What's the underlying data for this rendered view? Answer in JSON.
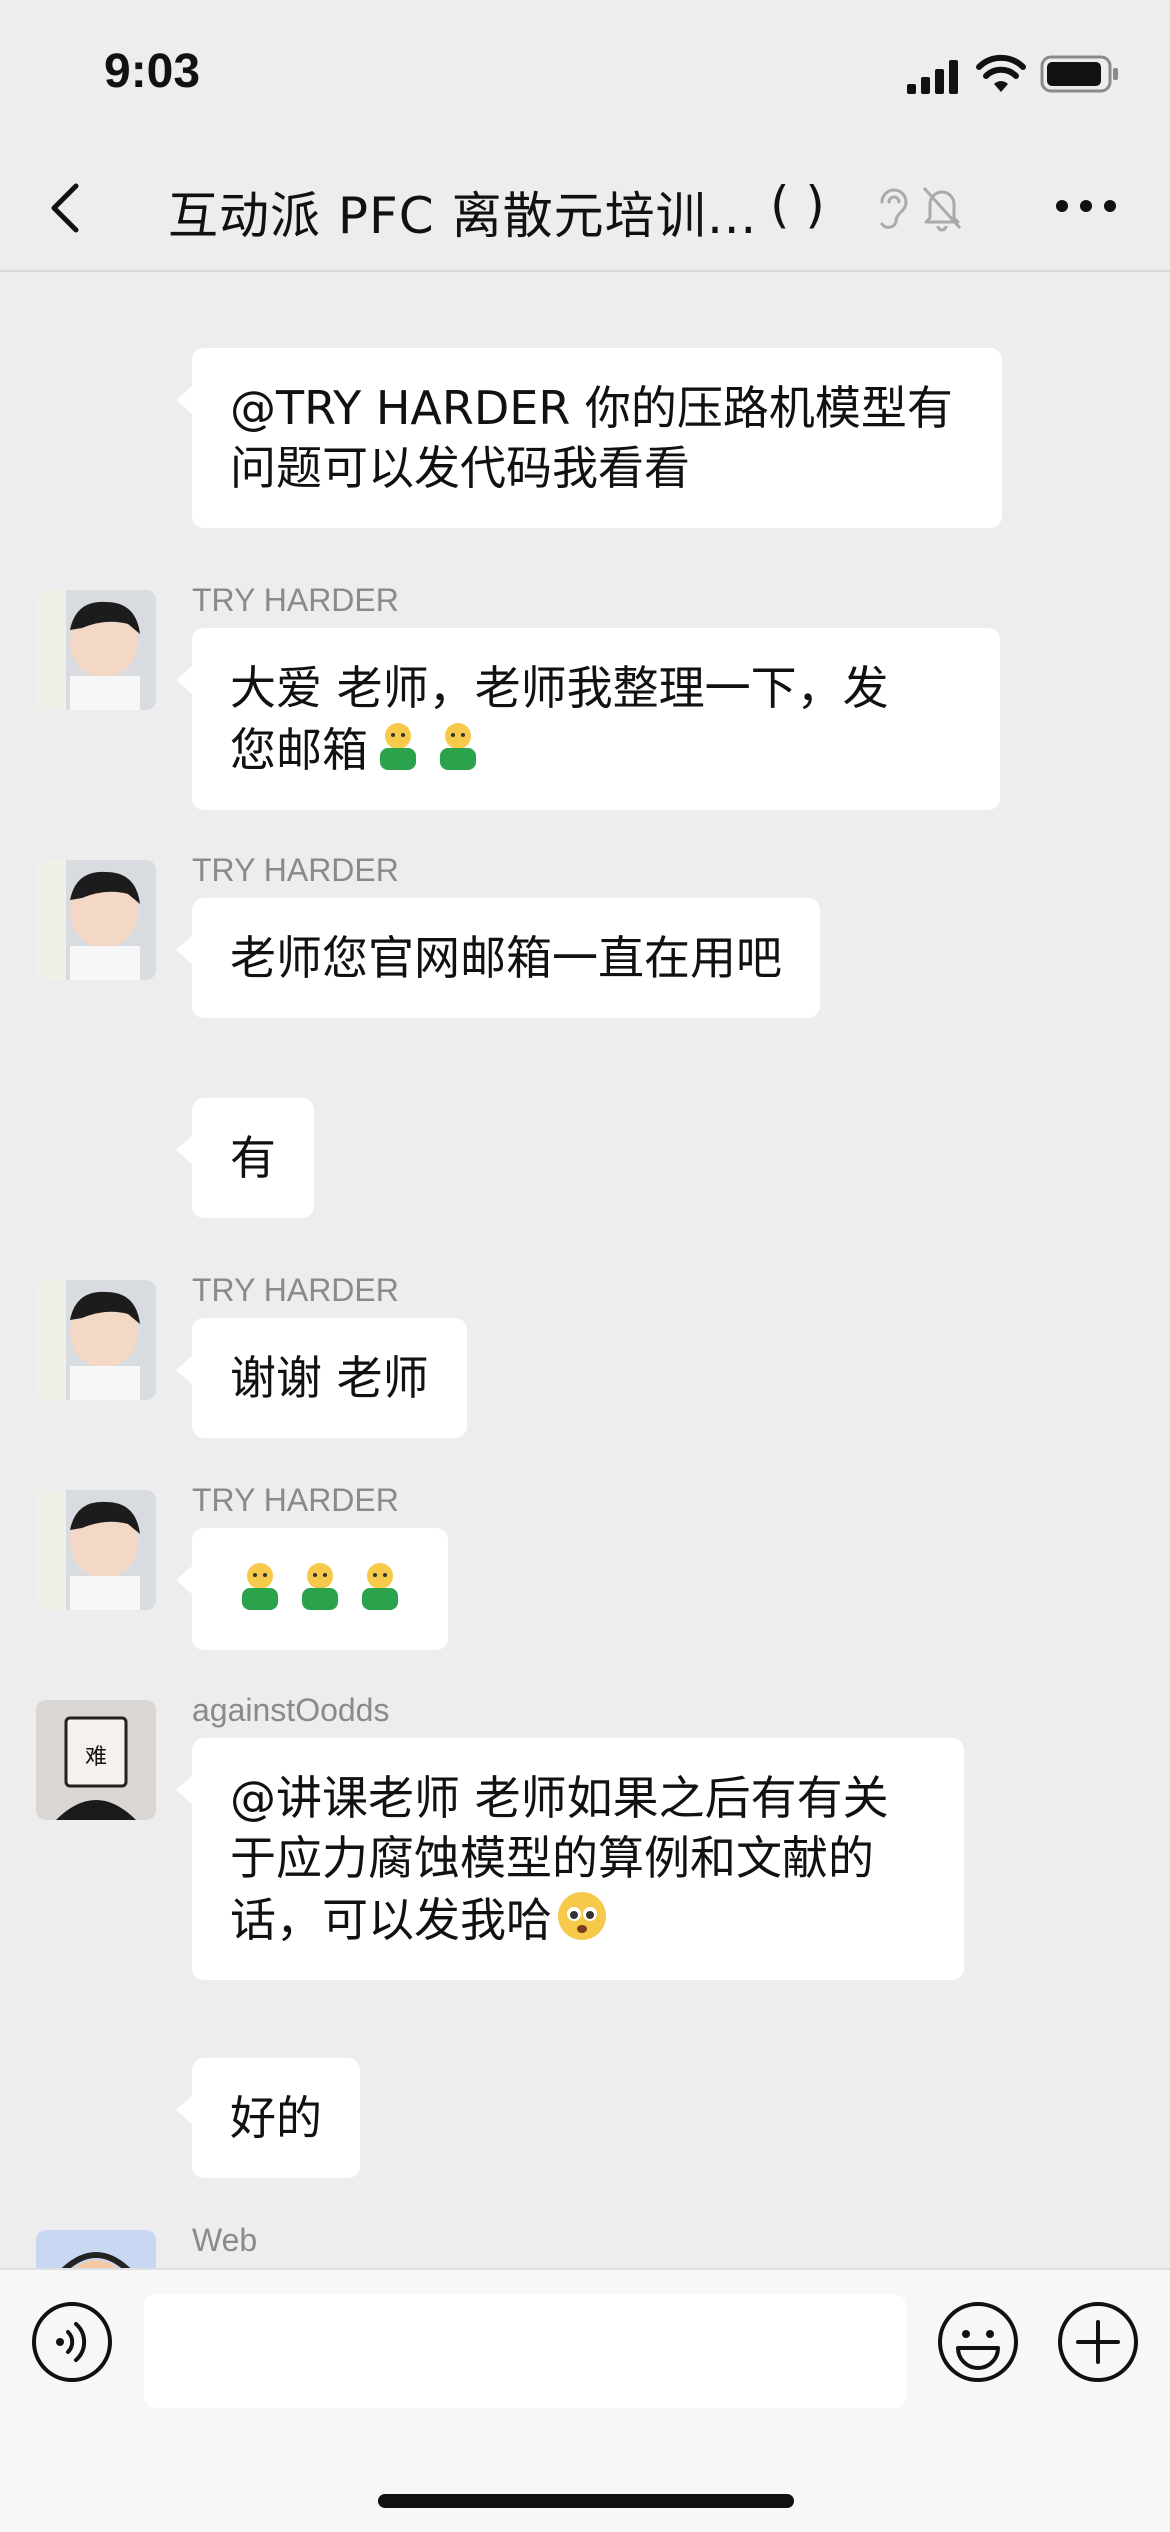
{
  "status": {
    "time": "9:03"
  },
  "header": {
    "title": "互动派 PFC 离散元培训…",
    "count": "(    )"
  },
  "messages": [
    {
      "type": "plain",
      "text": "@TRY HARDER 你的压路机模型有问题可以发代码我看看"
    },
    {
      "type": "avatar",
      "sender": "TRY HARDER",
      "line1": "大爱   老师，老师我整理一下，发",
      "line2": "您邮箱",
      "emojis": "worker-emoji x2"
    },
    {
      "type": "avatar",
      "sender": "TRY HARDER",
      "text": "老师您官网邮箱一直在用吧"
    },
    {
      "type": "plain",
      "text": "有"
    },
    {
      "type": "avatar",
      "sender": "TRY HARDER",
      "text": "谢谢   老师"
    },
    {
      "type": "avatar",
      "sender": "TRY HARDER",
      "emojis": "worker-emoji x3"
    },
    {
      "type": "avatar",
      "sender": "againstOodds",
      "line1": "@讲课老师 老师如果之后有有关",
      "line2": "于应力腐蚀模型的算例和文献的",
      "line3": "话，可以发我哈",
      "emojis": "pleading-emoji",
      "avatar_text": "难"
    },
    {
      "type": "plain",
      "text": "好的"
    },
    {
      "type": "avatar",
      "sender": "Web"
    }
  ],
  "input": {
    "placeholder": ""
  },
  "colors": {
    "background": "#ededed",
    "bubble": "#ffffff",
    "sender": "#8a8a8a"
  }
}
